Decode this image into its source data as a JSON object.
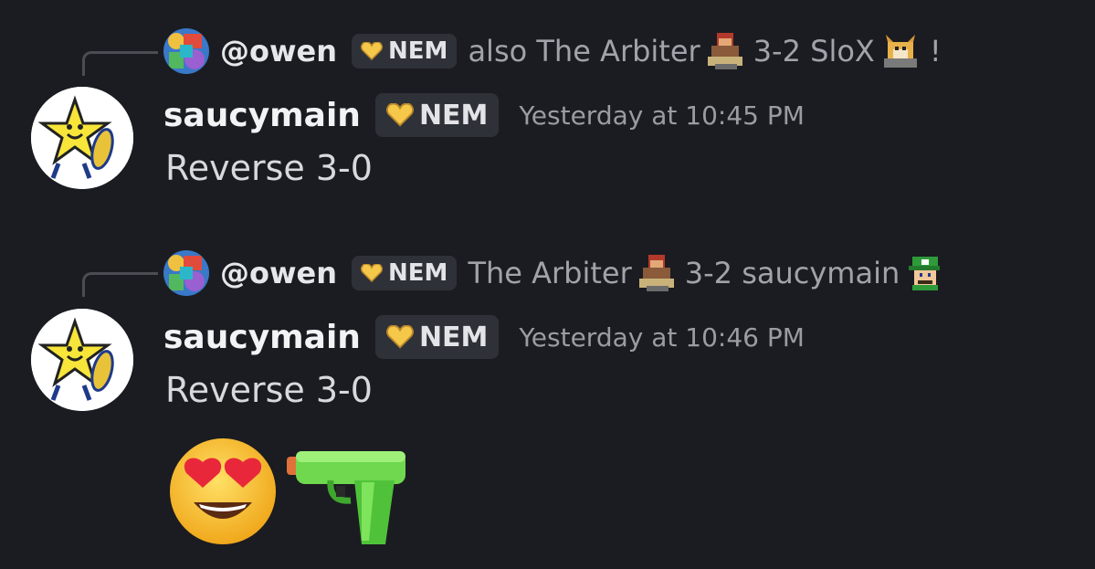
{
  "messages": [
    {
      "reply": {
        "mention": "@owen",
        "badge": "NEM",
        "text_before": "also The Arbiter",
        "text_middle": "3-2 SloX",
        "text_after": "!",
        "icons": [
          "warrior-emoji",
          "fox-emoji"
        ]
      },
      "author": "saucymain",
      "badge": "NEM",
      "timestamp": "Yesterday at 10:45 PM",
      "content": "Reverse 3-0"
    },
    {
      "reply": {
        "mention": "@owen",
        "badge": "NEM",
        "text_before": "The Arbiter",
        "text_middle": "3-2 saucymain",
        "text_after": "",
        "icons": [
          "warrior-emoji",
          "luigi-emoji"
        ]
      },
      "author": "saucymain",
      "badge": "NEM",
      "timestamp": "Yesterday at 10:46 PM",
      "content": "Reverse 3-0",
      "reactions_inline": [
        "heart-eyes-emoji",
        "water-pistol-emoji"
      ]
    }
  ],
  "colors": {
    "background": "#1b1c21",
    "badge_bg": "#2f3138",
    "heart_gold": "#f5c84a",
    "timestamp": "#9a9ca3"
  }
}
